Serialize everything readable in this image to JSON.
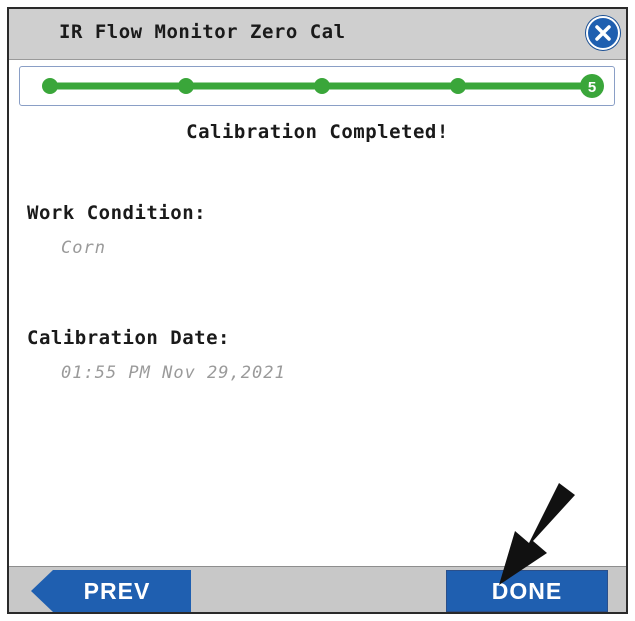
{
  "window": {
    "title": "IR Flow Monitor Zero Cal",
    "close_icon": "close-icon"
  },
  "progress": {
    "total_steps": 5,
    "current_step": 5,
    "current_step_label": "5",
    "color": "#3aa63a"
  },
  "main": {
    "heading": "Calibration Completed!",
    "work_condition_label": "Work Condition:",
    "work_condition_value": "Corn",
    "calibration_date_label": "Calibration Date:",
    "calibration_date_value": "01:55 PM Nov 29,2021"
  },
  "footer": {
    "prev_label": "PREV",
    "done_label": "DONE"
  },
  "colors": {
    "accent": "#1f5fb0",
    "bar_bg": "#cfcfcf",
    "progress_green": "#3aa63a"
  },
  "annotation": {
    "arrow_icon": "pointer-arrow-icon"
  }
}
